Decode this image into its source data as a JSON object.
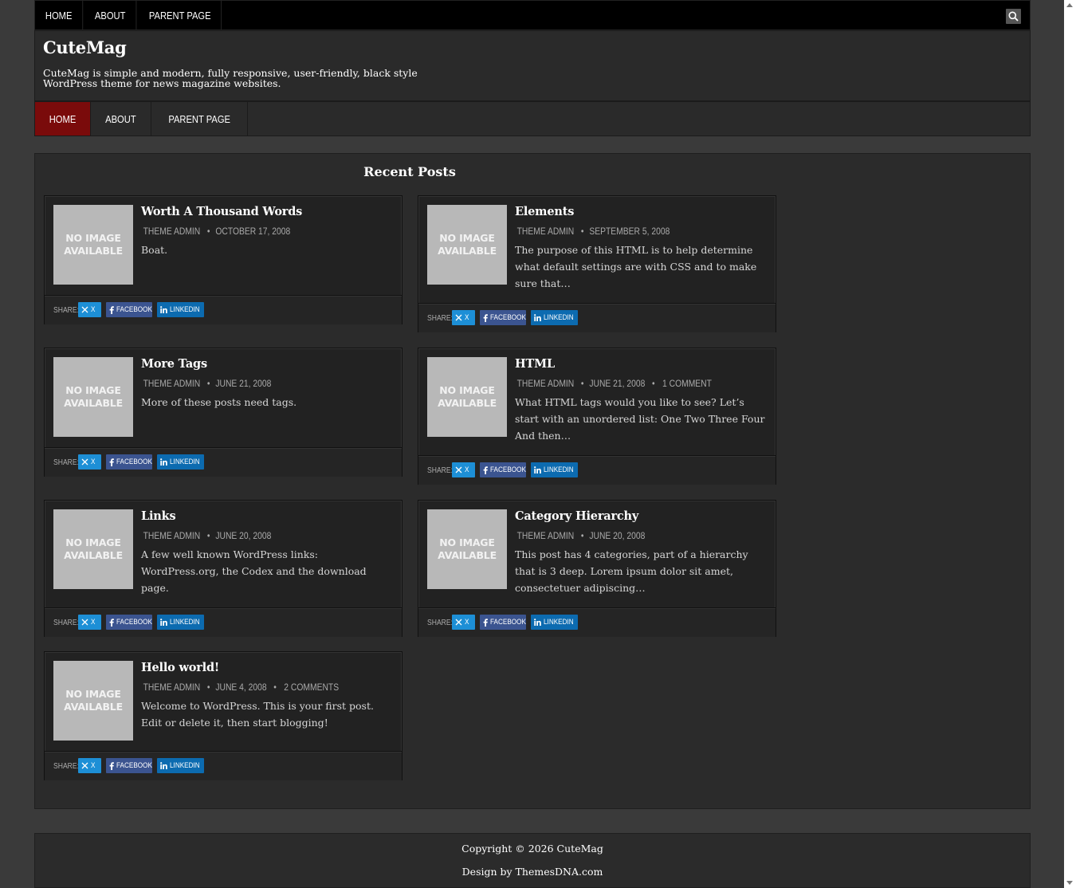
{
  "top_nav": {
    "items": [
      "Home",
      "About",
      "Parent Page"
    ]
  },
  "header": {
    "title": "CuteMag",
    "description": "CuteMag is simple and modern, fully responsive, user-friendly, black style WordPress theme for news magazine websites."
  },
  "main_nav": {
    "items": [
      "Home",
      "About",
      "Parent Page"
    ],
    "active": "Home"
  },
  "recent_posts": {
    "title": "Recent Posts",
    "thumb_text": [
      "NO IMAGE",
      "AVAILABLE"
    ],
    "share_label": "SHARE:",
    "share_buttons": {
      "x": "X",
      "facebook": "FACEBOOK",
      "linkedin": "LINKEDIN"
    },
    "posts": [
      {
        "title": "Worth A Thousand Words",
        "author": "THEME ADMIN",
        "date": "OCTOBER 17, 2008",
        "comments": "",
        "excerpt": "Boat."
      },
      {
        "title": "Elements",
        "author": "THEME ADMIN",
        "date": "SEPTEMBER 5, 2008",
        "comments": "",
        "excerpt": "The purpose of this HTML is to help determine what default settings are with CSS and to make sure that…"
      },
      {
        "title": "More Tags",
        "author": "THEME ADMIN",
        "date": "JUNE 21, 2008",
        "comments": "",
        "excerpt": "More of these posts need tags."
      },
      {
        "title": "HTML",
        "author": "THEME ADMIN",
        "date": "JUNE 21, 2008",
        "comments": "1 COMMENT",
        "excerpt": "What HTML tags would you like to see? Let’s start with an unordered list: One Two Three Four And then…"
      },
      {
        "title": "Links",
        "author": "THEME ADMIN",
        "date": "JUNE 20, 2008",
        "comments": "",
        "excerpt": "A few well known WordPress links: WordPress.org, the Codex and the download page."
      },
      {
        "title": "Category Hierarchy",
        "author": "THEME ADMIN",
        "date": "JUNE 20, 2008",
        "comments": "",
        "excerpt": "This post has 4 categories, part of a hierarchy that is 3 deep. Lorem ipsum dolor sit amet, consectetuer adipiscing…"
      },
      {
        "title": "Hello world!",
        "author": "THEME ADMIN",
        "date": "JUNE 4, 2008",
        "comments": "2 COMMENTS",
        "excerpt": "Welcome to WordPress. This is your first post. Edit or delete it, then start blogging!"
      }
    ]
  },
  "footer": {
    "copyright": "Copyright © 2026 CuteMag",
    "design_by": "Design by ThemesDNA.com"
  },
  "colors": {
    "active_nav": "#7a0b0b",
    "x": "#1d8fd6",
    "facebook": "#3b5490",
    "linkedin": "#0c6bb0"
  }
}
